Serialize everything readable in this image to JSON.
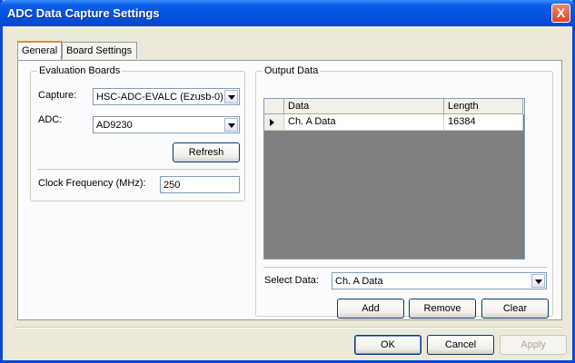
{
  "window": {
    "title": "ADC Data Capture Settings",
    "close_label": "X"
  },
  "tabs": [
    {
      "label": "General"
    },
    {
      "label": "Board Settings"
    }
  ],
  "evaluation_boards": {
    "legend": "Evaluation Boards",
    "capture_label": "Capture:",
    "capture_value": "HSC-ADC-EVALC (Ezusb-0)",
    "adc_label": "ADC:",
    "adc_value": "AD9230",
    "refresh_label": "Refresh",
    "clock_label": "Clock Frequency (MHz):",
    "clock_value": "250"
  },
  "output_data": {
    "legend": "Output Data",
    "columns": [
      "Data",
      "Length"
    ],
    "rows": [
      {
        "data": "Ch. A Data",
        "length": "16384"
      }
    ],
    "select_label": "Select Data:",
    "select_value": "Ch. A Data",
    "add_label": "Add",
    "remove_label": "Remove",
    "clear_label": "Clear"
  },
  "footer": {
    "ok_label": "OK",
    "cancel_label": "Cancel",
    "apply_label": "Apply"
  }
}
